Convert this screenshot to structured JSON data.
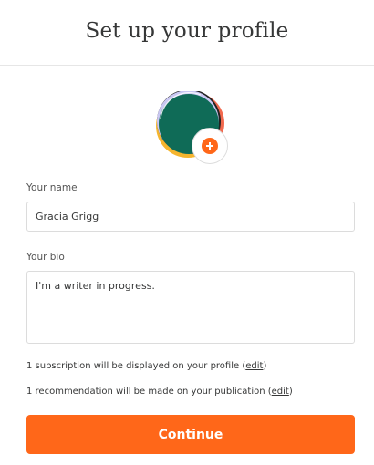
{
  "header": {
    "title": "Set up your profile"
  },
  "avatar": {
    "icon": "plus-icon",
    "colors": {
      "green": "#0f6b57",
      "orange": "#ff6719",
      "lavender": "#c9c7f2",
      "yellow": "#f5b52e",
      "coral": "#f2694e",
      "black": "#222222"
    }
  },
  "form": {
    "name_label": "Your name",
    "name_value": "Gracia Grigg",
    "bio_label": "Your bio",
    "bio_value": "I'm a writer in progress."
  },
  "notes": {
    "subscription_text": "1 subscription will be displayed on your profile (",
    "subscription_link": "edit",
    "subscription_close": ")",
    "recommendation_text": "1 recommendation will be made on your publication (",
    "recommendation_link": "edit",
    "recommendation_close": ")"
  },
  "actions": {
    "continue_label": "Continue"
  },
  "colors": {
    "accent": "#ff6719",
    "border": "#dcdcdc",
    "text": "#363737"
  }
}
